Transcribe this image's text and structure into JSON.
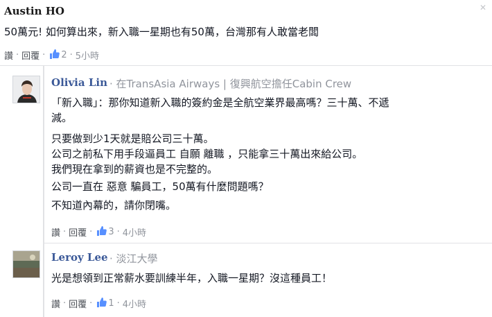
{
  "comments": [
    {
      "author": "Austin HO",
      "text": [
        "50萬元! 如何算出來，新入職一星期也有50萬，台灣那有人敢當老闆"
      ],
      "actions": {
        "like": "讚",
        "reply": "回覆",
        "like_count": "2",
        "time": "5小時"
      }
    },
    {
      "author": "Olivia Lin",
      "affiliation": "在TransAsia Airways | 復興航空擔任Cabin Crew",
      "text": [
        "「新入職」：那你知道新入職的簽約金是全航空業界最高嗎？三十萬、不遞",
        "減。",
        "只要做到少1天就是賠公司三十萬。",
        "公司之前私下用手段逼員工 自願 離職 ，只能拿三十萬出來給公司。",
        "我們現在拿到的薪資也是不完整的。",
        "公司一直在 惡意 騙員工，50萬有什麼問題嗎？",
        "不知道內幕的，請你閉嘴。"
      ],
      "actions": {
        "like": "讚",
        "reply": "回覆",
        "like_count": "3",
        "time": "4小時"
      }
    },
    {
      "author": "Leroy Lee",
      "affiliation": "淡江大學",
      "text": [
        "光是想領到正常薪水要訓練半年，入職一星期？沒這種員工！"
      ],
      "actions": {
        "like": "讚",
        "reply": "回覆",
        "like_count": "1",
        "time": "4小時"
      }
    }
  ],
  "icons": {
    "like": "thumbs-up-icon",
    "close": "close-icon"
  },
  "colors": {
    "name_link": "#3b5998",
    "meta": "#90949c",
    "text": "#141823",
    "thumb": "#5890ff"
  }
}
